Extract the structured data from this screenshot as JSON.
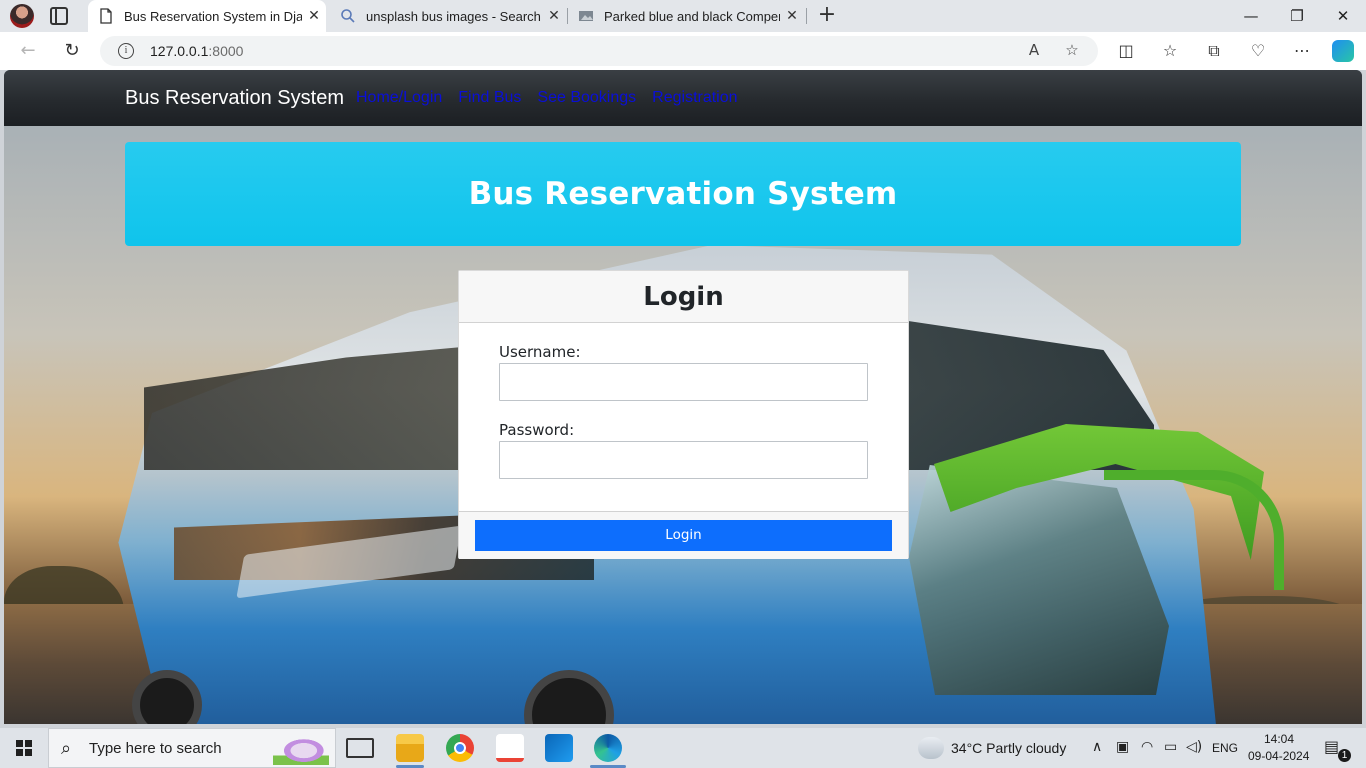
{
  "browser": {
    "tabs": [
      {
        "title": "Bus Reservation System in Django",
        "active": true,
        "icon": "page-icon"
      },
      {
        "title": "unsplash bus images - Search",
        "active": false,
        "icon": "search-icon"
      },
      {
        "title": "Parked blue and black Compertur",
        "active": false,
        "icon": "image-icon"
      }
    ],
    "url_host": "127.0.0.1",
    "url_port": ":8000"
  },
  "site": {
    "brand": "Bus Reservation System",
    "nav_links": [
      "Home/Login",
      "Find Bus",
      "See Bookings",
      "Registration"
    ],
    "hero_title": "Bus Reservation System",
    "colors": {
      "hero": "#0fc4ec",
      "navbar": "#262a2e",
      "link": "#0a0fd8",
      "primary_button": "#0d6efd"
    }
  },
  "login": {
    "title": "Login",
    "username_label": "Username:",
    "username_value": "",
    "password_label": "Password:",
    "password_value": "",
    "submit_label": "Login"
  },
  "taskbar": {
    "search_placeholder": "Type here to search",
    "weather": "34°C  Partly cloudy",
    "language": "ENG",
    "time": "14:04",
    "date": "09-04-2024",
    "notification_count": "1"
  }
}
